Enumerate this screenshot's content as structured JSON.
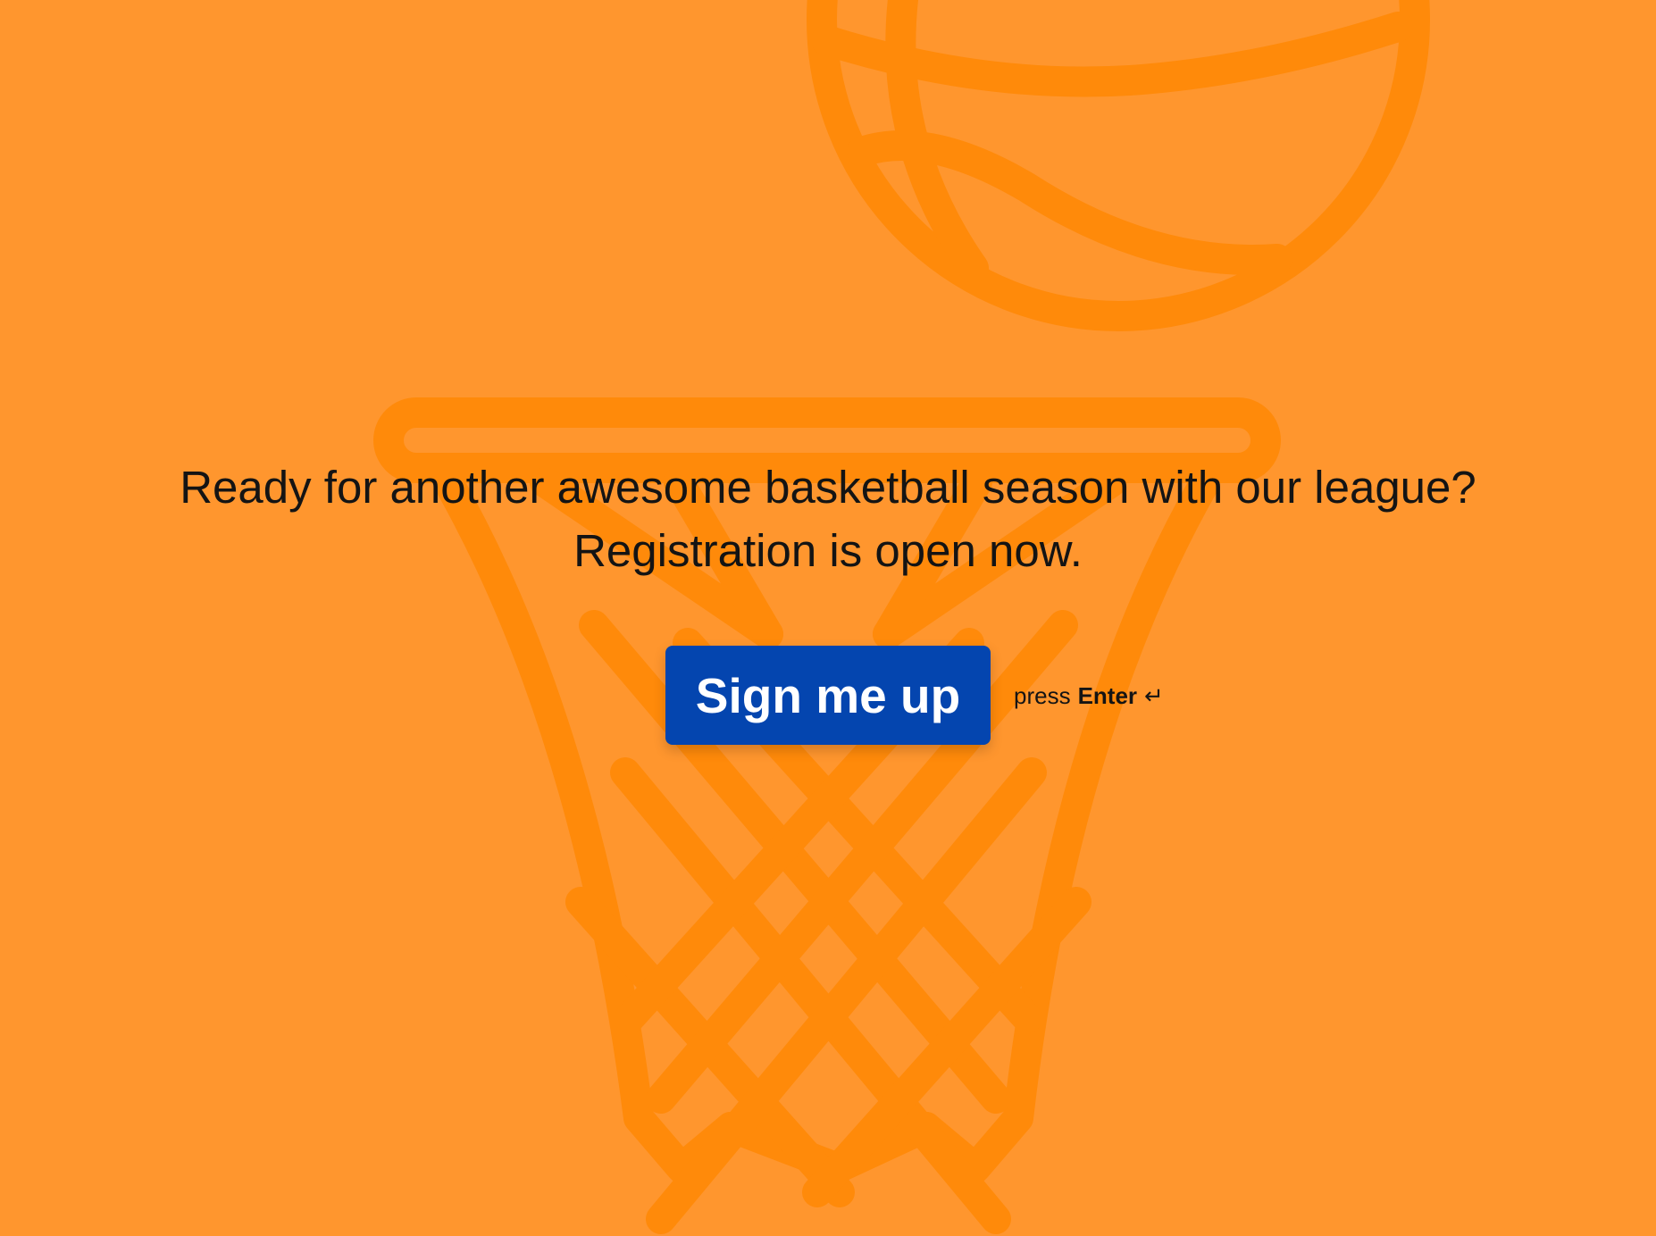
{
  "theme": {
    "background": "#FF962E",
    "illustration_stroke": "#FF8A0A",
    "button_color": "#0445AF",
    "text_color": "#141414"
  },
  "illustration": {
    "ball_icon": "basketball-icon",
    "hoop_icon": "basketball-hoop-icon"
  },
  "welcome": {
    "line1": "Ready for another awesome basketball season with our league?",
    "line2": "Registration is open now."
  },
  "cta": {
    "label": "Sign me up"
  },
  "keyboard_hint": {
    "prefix": "press",
    "key": "Enter",
    "icon": "enter-return-icon",
    "glyph": "↵"
  }
}
